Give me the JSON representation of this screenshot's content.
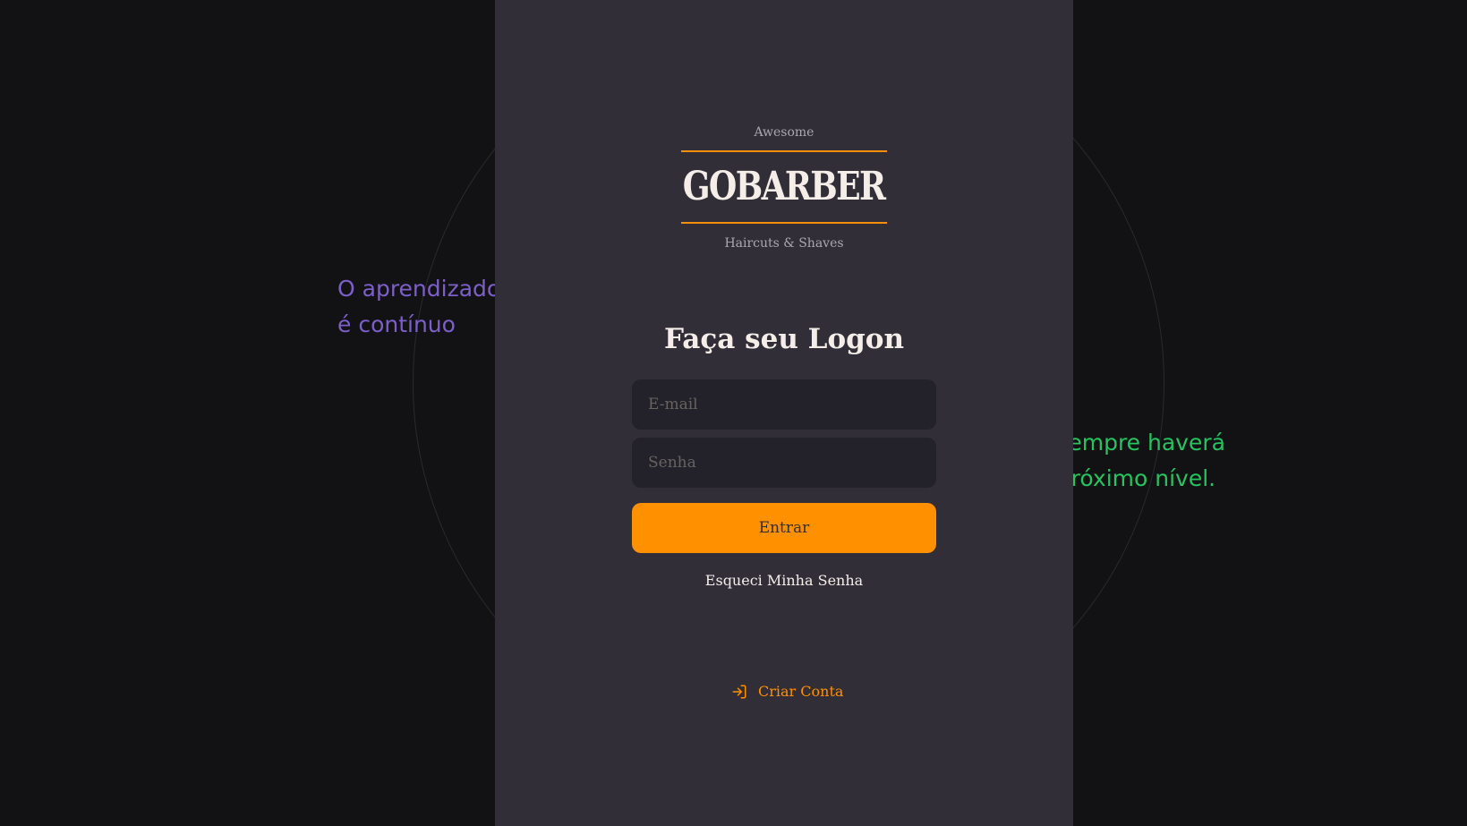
{
  "background": {
    "quote_left": [
      "O aprendizado",
      "é contínuo"
    ],
    "quote_right": [
      "e sempre haverá",
      "n próximo nível."
    ]
  },
  "logo": {
    "top_text": "Awesome",
    "brand": "GOBARBER",
    "bottom_text": "Haircuts & Shaves"
  },
  "form": {
    "title": "Faça seu Logon",
    "email_placeholder": "E-mail",
    "password_placeholder": "Senha",
    "email_value": "",
    "password_value": "",
    "submit_label": "Entrar",
    "forgot_label": "Esqueci Minha Senha"
  },
  "create_account": {
    "label": "Criar Conta",
    "icon": "log-in-icon"
  },
  "colors": {
    "background": "#121214",
    "panel": "#312e38",
    "input": "#232129",
    "accent": "#ff9000",
    "text": "#f4ede8",
    "placeholder": "#666360",
    "quote_left": "#7c5fc9",
    "quote_right": "#24c45e"
  }
}
